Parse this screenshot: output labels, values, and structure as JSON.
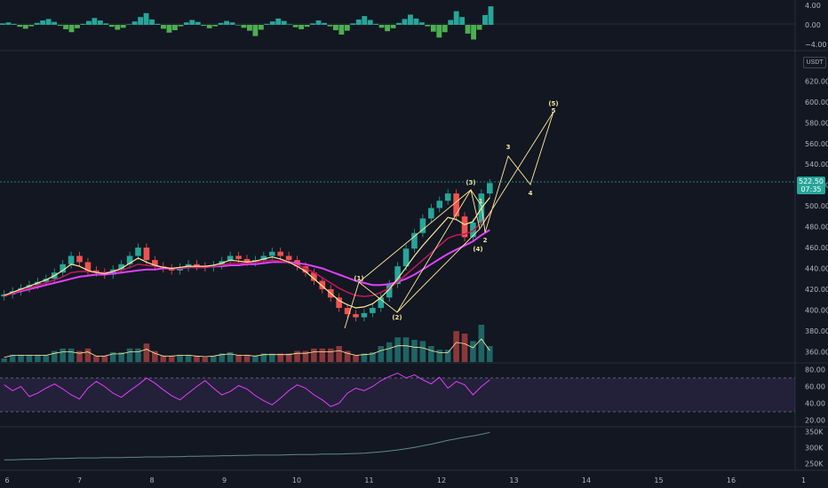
{
  "colors": {
    "background": "#131722",
    "pane_separator": "#2a2e39",
    "grid_dashed": "#2a2e39",
    "candle_up": "#26a69a",
    "candle_down": "#ef5350",
    "histogram_pos": "#26a69a",
    "histogram_neg": "#4caf50",
    "ma_fast": "#ffeb9c",
    "ma_mid": "#c2185b",
    "ma_slow": "#e040fb",
    "wave_lines": "#ffeb9c",
    "rsi_line": "#e040fb",
    "rsi_band": "#7e57c2",
    "obv_line": "#5d8a87",
    "price_tag": "#26a69a",
    "volume_ma": "#ffeb9c"
  },
  "unit_label": "USDT",
  "price_tag": {
    "price": "522.50",
    "countdown": "07:35"
  },
  "chart_data": [
    {
      "type": "bar",
      "title": "",
      "ylim": [
        -4,
        4
      ],
      "y_ticks": [
        "4.00",
        "0.00",
        "−4.00"
      ],
      "series": [
        {
          "values": [
            0.3,
            0.5,
            0.2,
            -0.4,
            -0.8,
            -0.3,
            0.4,
            0.9,
            1.2,
            0.6,
            -0.2,
            -0.9,
            -1.5,
            -0.7,
            0.2,
            0.8,
            1.4,
            0.9,
            0.3,
            -0.4,
            -1.0,
            -0.6,
            0.1,
            0.7,
            1.6,
            2.4,
            1.1,
            0.2,
            -0.8,
            -1.6,
            -1.1,
            -0.3,
            0.5,
            1.0,
            0.6,
            -0.2,
            -0.7,
            -0.3,
            0.4,
            0.8,
            0.5,
            -0.1,
            -0.6,
            -1.2,
            -2.3,
            -1.0,
            0.2,
            0.7,
            1.3,
            0.8,
            0.1,
            -0.5,
            -0.9,
            -0.4,
            0.3,
            0.9,
            0.4,
            -0.3,
            -1.1,
            -2.0,
            -1.2,
            0.3,
            1.1,
            1.8,
            1.0,
            0.2,
            -0.6,
            -1.3,
            -0.7,
            0.4,
            1.2,
            2.1,
            1.3,
            0.5,
            -0.3,
            -1.4,
            -2.6,
            -1.5,
            1.0,
            2.8,
            1.6,
            -1.8,
            -3.0,
            -1.0,
            2.0,
            3.8
          ]
        }
      ]
    },
    {
      "type": "line",
      "title": "",
      "x_ticks": [
        "6",
        "7",
        "8",
        "9",
        "10",
        "11",
        "12",
        "13",
        "14",
        "15",
        "16",
        "1"
      ],
      "y_ticks": [
        "620.00",
        "600.00",
        "580.00",
        "560.00",
        "540.00",
        "520.00",
        "500.00",
        "480.00",
        "460.00",
        "440.00",
        "420.00",
        "400.00",
        "380.00",
        "360.00"
      ],
      "ylim": [
        350,
        640
      ],
      "series": [
        {
          "values": [
            415,
            418,
            421,
            424,
            427,
            430,
            436,
            444,
            452,
            446,
            438,
            436,
            434,
            439,
            444,
            452,
            460,
            448,
            442,
            440,
            438,
            441,
            444,
            442,
            441,
            443,
            447,
            452,
            449,
            446,
            448,
            452,
            456,
            452,
            448,
            442,
            436,
            428,
            420,
            412,
            402,
            396,
            393,
            397,
            402,
            412,
            425,
            442,
            459,
            474,
            488,
            498,
            505,
            512,
            490,
            470,
            484,
            512,
            522
          ]
        },
        {
          "values": [
            414,
            417,
            420,
            423,
            426,
            429,
            433,
            438,
            444,
            442,
            438,
            436,
            435,
            437,
            440,
            445,
            450,
            446,
            443,
            441,
            440,
            441,
            442,
            442,
            442,
            443,
            445,
            448,
            447,
            446,
            447,
            449,
            451,
            449,
            446,
            442,
            437,
            430,
            423,
            416,
            409,
            405,
            402,
            403,
            406,
            412,
            420,
            430,
            441,
            452,
            462,
            471,
            480,
            489,
            487,
            482,
            485,
            498,
            508
          ]
        },
        {
          "values": [
            413,
            416,
            419,
            421,
            424,
            426,
            429,
            432,
            436,
            437,
            437,
            436,
            436,
            437,
            438,
            441,
            444,
            443,
            442,
            441,
            440,
            440,
            441,
            441,
            441,
            442,
            443,
            445,
            445,
            445,
            446,
            447,
            448,
            447,
            446,
            443,
            440,
            436,
            431,
            426,
            421,
            417,
            414,
            413,
            414,
            417,
            421,
            427,
            434,
            441,
            448,
            455,
            462,
            469,
            472,
            473,
            476,
            484,
            492
          ]
        },
        {
          "values": [
            414,
            416,
            418,
            420,
            422,
            424,
            426,
            428,
            430,
            432,
            433,
            434,
            434,
            435,
            436,
            437,
            438,
            439,
            439,
            440,
            440,
            440,
            441,
            441,
            441,
            442,
            442,
            443,
            443,
            444,
            444,
            445,
            446,
            446,
            446,
            445,
            444,
            442,
            440,
            437,
            434,
            431,
            428,
            426,
            424,
            424,
            425,
            427,
            430,
            434,
            439,
            444,
            449,
            454,
            458,
            462,
            466,
            472,
            477
          ]
        }
      ],
      "wave_labels": [
        "(1)",
        "(2)",
        "(3)",
        "(4)",
        "(5)",
        "1",
        "2",
        "3",
        "4",
        "5"
      ]
    },
    {
      "type": "line",
      "title": "",
      "ylim": [
        15,
        85
      ],
      "y_ticks": [
        "80.00",
        "60.00",
        "40.00",
        "20.00"
      ],
      "series": [
        {
          "values": [
            62,
            55,
            60,
            48,
            52,
            58,
            63,
            57,
            50,
            45,
            58,
            66,
            60,
            52,
            47,
            55,
            62,
            70,
            64,
            56,
            49,
            44,
            52,
            60,
            67,
            58,
            50,
            54,
            61,
            57,
            49,
            43,
            38,
            46,
            55,
            62,
            58,
            50,
            44,
            36,
            40,
            52,
            58,
            55,
            60,
            67,
            72,
            76,
            70,
            74,
            68,
            63,
            71,
            58,
            66,
            62,
            50,
            60,
            68
          ]
        }
      ]
    },
    {
      "type": "line",
      "title": "",
      "ylim": [
        235,
        360
      ],
      "y_ticks": [
        "350K",
        "300K",
        "250K"
      ],
      "series": [
        {
          "values": [
            262,
            262,
            263,
            264,
            264,
            265,
            266,
            266,
            267,
            268,
            268,
            268,
            269,
            269,
            269,
            270,
            270,
            271,
            271,
            271,
            272,
            272,
            273,
            273,
            274,
            274,
            275,
            275,
            276,
            276,
            277,
            277,
            277,
            277,
            278,
            279,
            279,
            279,
            280,
            280,
            280,
            281,
            282,
            283,
            285,
            287,
            290,
            293,
            297,
            301,
            306,
            311,
            317,
            323,
            328,
            333,
            337,
            342,
            348
          ]
        }
      ]
    }
  ]
}
